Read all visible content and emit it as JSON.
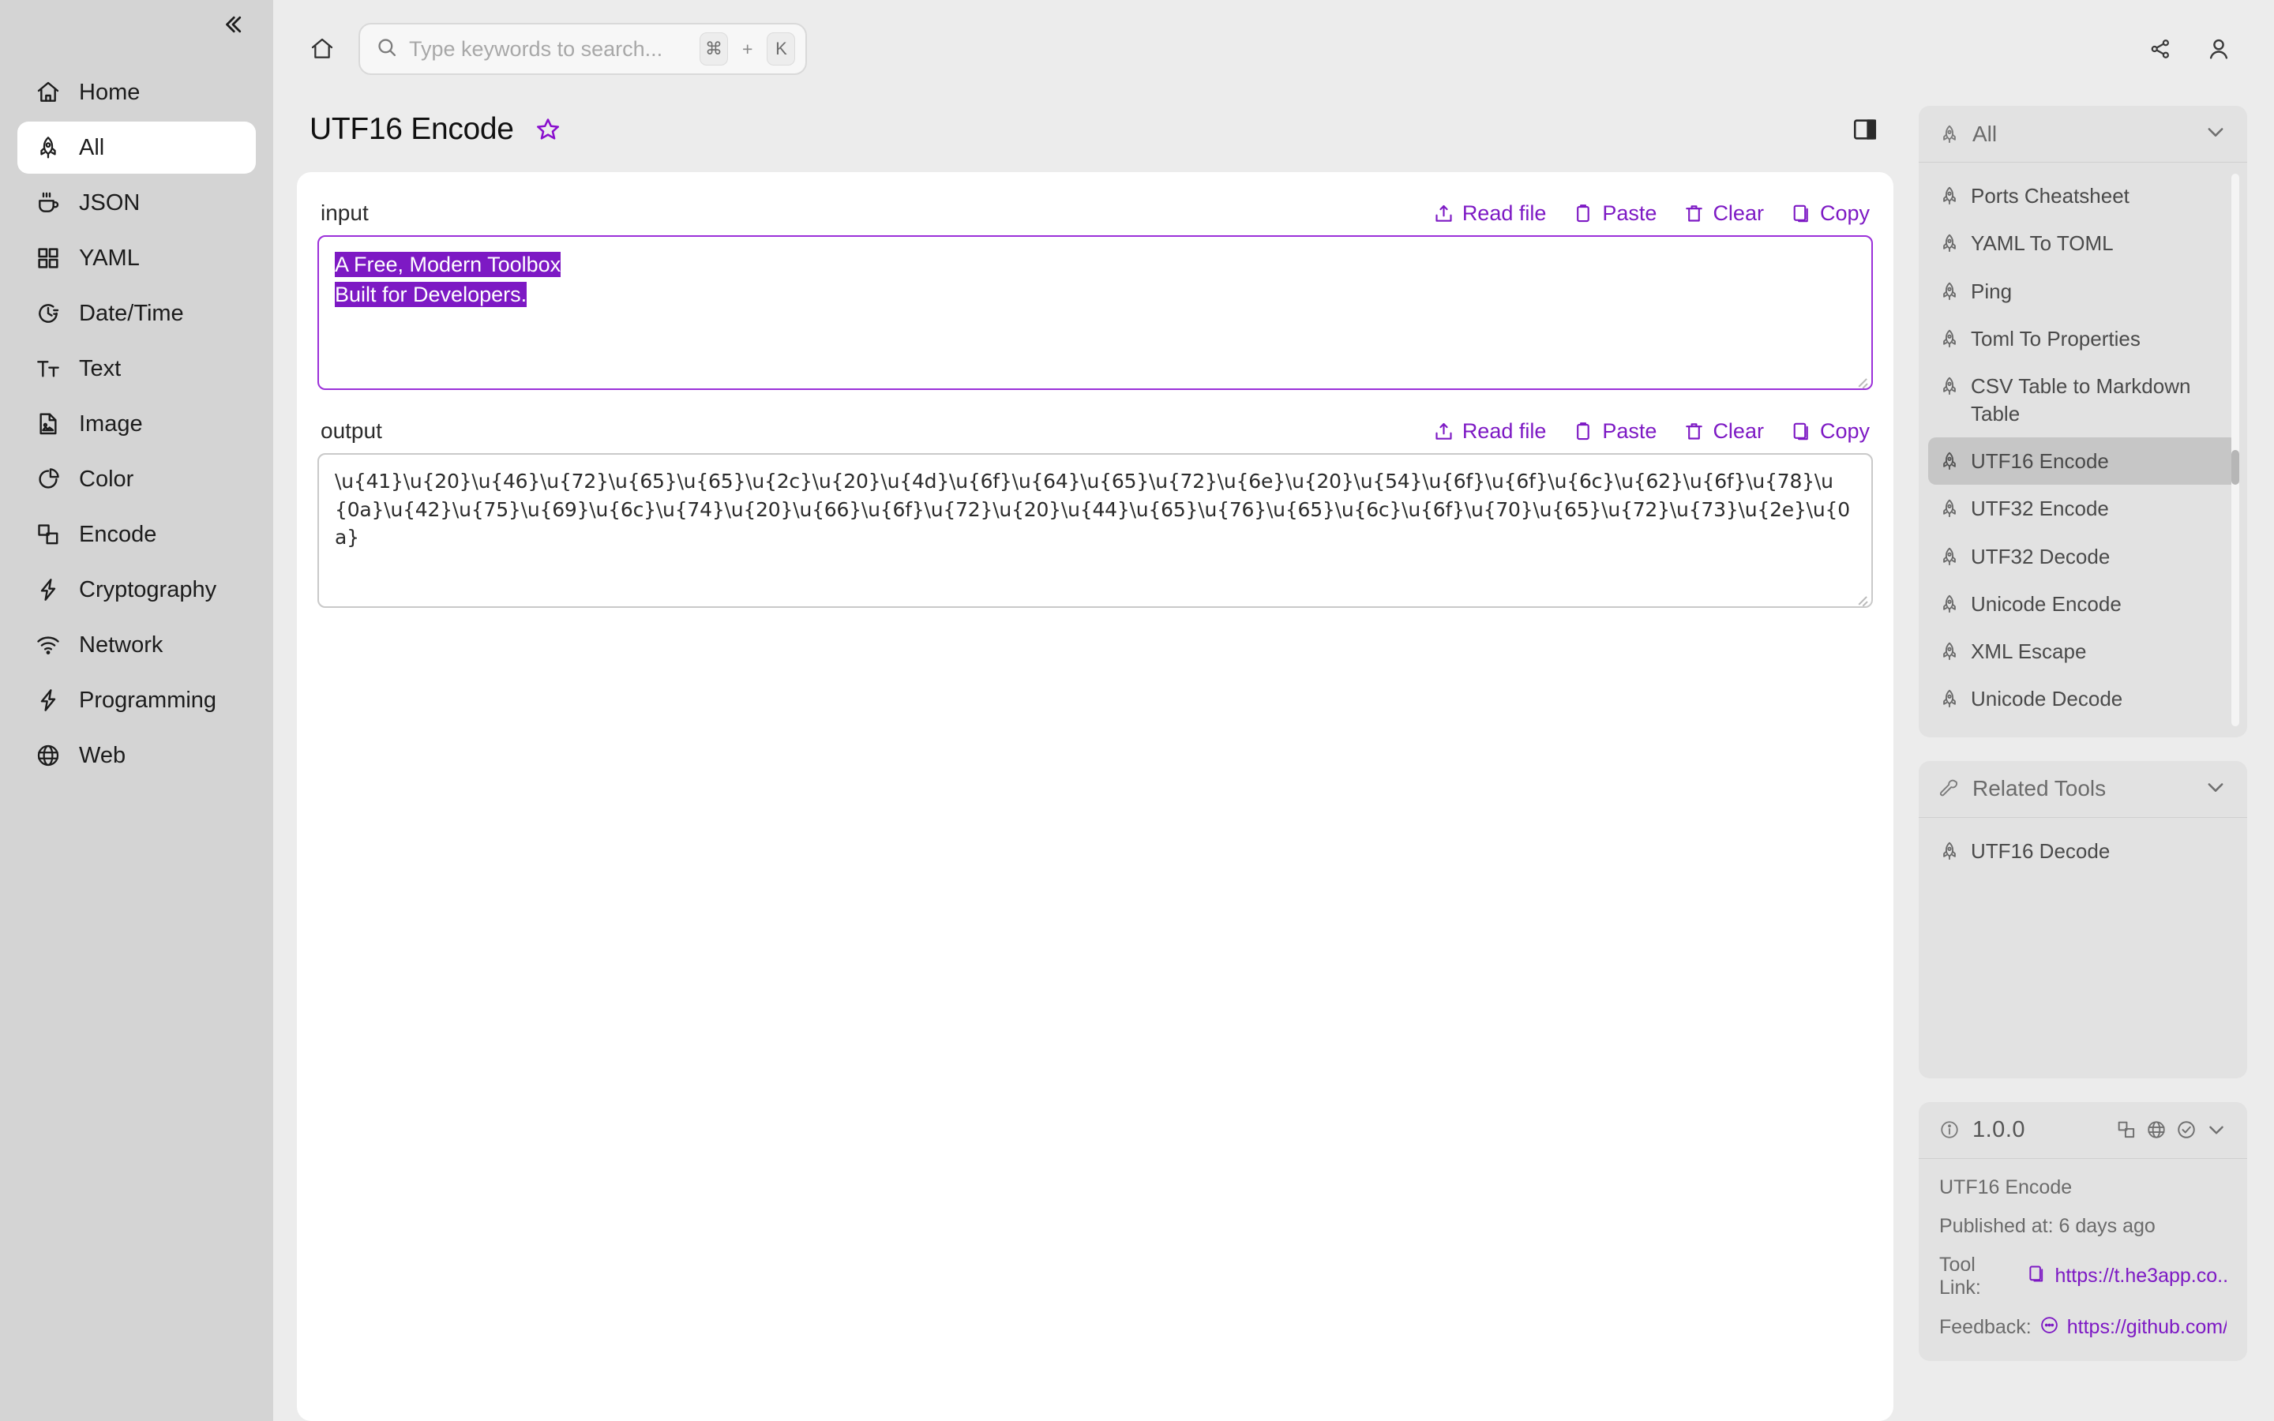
{
  "sidebar": {
    "collapse_icon": "chevrons-left-icon",
    "items": [
      {
        "label": "Home",
        "icon": "home-icon",
        "active": false
      },
      {
        "label": "All",
        "icon": "rocket-icon",
        "active": true
      },
      {
        "label": "JSON",
        "icon": "coffee-icon",
        "active": false
      },
      {
        "label": "YAML",
        "icon": "grid-icon",
        "active": false
      },
      {
        "label": "Date/Time",
        "icon": "clock-icon",
        "active": false
      },
      {
        "label": "Text",
        "icon": "text-format-icon",
        "active": false
      },
      {
        "label": "Image",
        "icon": "image-file-icon",
        "active": false
      },
      {
        "label": "Color",
        "icon": "pie-chart-icon",
        "active": false
      },
      {
        "label": "Encode",
        "icon": "copy-layers-icon",
        "active": false
      },
      {
        "label": "Cryptography",
        "icon": "bolt-icon",
        "active": false
      },
      {
        "label": "Network",
        "icon": "wifi-icon",
        "active": false
      },
      {
        "label": "Programming",
        "icon": "bolt-icon",
        "active": false
      },
      {
        "label": "Web",
        "icon": "globe-icon",
        "active": false
      }
    ]
  },
  "topbar": {
    "home_icon": "home-icon",
    "search": {
      "placeholder": "Type keywords to search...",
      "value": "",
      "shortcut_key_1": "⌘",
      "shortcut_plus": "+",
      "shortcut_key_2": "K"
    },
    "share_icon": "share-icon",
    "account_icon": "user-icon"
  },
  "page": {
    "title": "UTF16 Encode",
    "favorite_icon": "star-icon",
    "panel_toggle_icon": "right-panel-icon"
  },
  "io": {
    "input": {
      "label": "input",
      "actions": [
        {
          "label": "Read file",
          "icon": "upload-icon"
        },
        {
          "label": "Paste",
          "icon": "clipboard-icon"
        },
        {
          "label": "Clear",
          "icon": "trash-icon"
        },
        {
          "label": "Copy",
          "icon": "copy-icon"
        }
      ],
      "value_line_1": "A Free, Modern Toolbox",
      "value_line_2": "Built for Developers.",
      "selected": true
    },
    "output": {
      "label": "output",
      "actions": [
        {
          "label": "Read file",
          "icon": "upload-icon"
        },
        {
          "label": "Paste",
          "icon": "clipboard-icon"
        },
        {
          "label": "Clear",
          "icon": "trash-icon"
        },
        {
          "label": "Copy",
          "icon": "copy-icon"
        }
      ],
      "value": "\\u{41}\\u{20}\\u{46}\\u{72}\\u{65}\\u{65}\\u{2c}\\u{20}\\u{4d}\\u{6f}\\u{64}\\u{65}\\u{72}\\u{6e}\\u{20}\\u{54}\\u{6f}\\u{6f}\\u{6c}\\u{62}\\u{6f}\\u{78}\\u{0a}\\u{42}\\u{75}\\u{69}\\u{6c}\\u{74}\\u{20}\\u{66}\\u{6f}\\u{72}\\u{20}\\u{44}\\u{65}\\u{76}\\u{65}\\u{6c}\\u{6f}\\u{70}\\u{65}\\u{72}\\u{73}\\u{2e}\\u{0a}"
    }
  },
  "rail": {
    "tools_panel": {
      "title": "All",
      "icon": "rocket-icon",
      "chevron_icon": "chevron-down-icon",
      "items": [
        {
          "label": "Ports Cheatsheet",
          "active": false
        },
        {
          "label": "YAML To TOML",
          "active": false
        },
        {
          "label": "Ping",
          "active": false
        },
        {
          "label": "Toml To Properties",
          "active": false
        },
        {
          "label": "CSV Table to Markdown Table",
          "active": false
        },
        {
          "label": "UTF16 Encode",
          "active": true
        },
        {
          "label": "UTF32 Encode",
          "active": false
        },
        {
          "label": "UTF32 Decode",
          "active": false
        },
        {
          "label": "Unicode Encode",
          "active": false
        },
        {
          "label": "XML Escape",
          "active": false
        },
        {
          "label": "Unicode Decode",
          "active": false
        }
      ]
    },
    "related_panel": {
      "title": "Related Tools",
      "icon": "wrench-icon",
      "chevron_icon": "chevron-down-icon",
      "items": [
        {
          "label": "UTF16 Decode",
          "active": false
        }
      ]
    },
    "info_panel": {
      "version": "1.0.0",
      "info_icon": "info-circle-icon",
      "head_icons": [
        "copy-layers-icon",
        "globe-icon",
        "check-circle-icon",
        "chevron-down-icon"
      ],
      "tool_name": "UTF16 Encode",
      "published_label": "Published at: 6 days ago",
      "tool_link_label": "Tool Link:",
      "tool_link_icon": "copy-icon",
      "tool_link_value": "https://t.he3app.co...",
      "feedback_label": "Feedback:",
      "feedback_icon": "comment-icon",
      "feedback_value": "https://github.com/..."
    }
  },
  "colors": {
    "accent": "#7d19c4",
    "sidebar_bg": "#d4d4d4",
    "main_bg": "#ececec",
    "card_bg": "#ffffff",
    "rail_card_bg": "#e2e2e2",
    "selection_bg": "#7d19c4"
  }
}
